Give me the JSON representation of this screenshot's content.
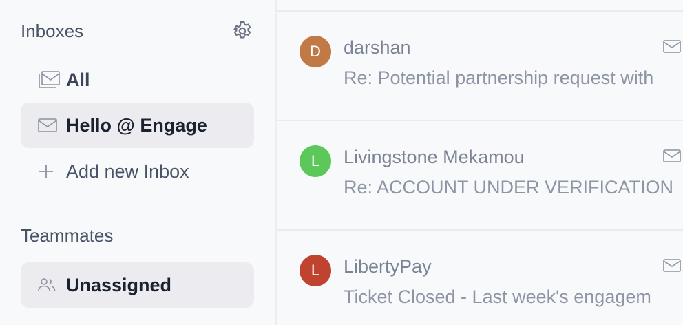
{
  "sidebar": {
    "inboxes_title": "Inboxes",
    "inbox_items": [
      {
        "label": "All",
        "icon": "inbox-stack-icon"
      },
      {
        "label": "Hello @ Engage",
        "icon": "mail-icon"
      },
      {
        "label": "Add new Inbox",
        "icon": "plus-icon"
      }
    ],
    "teammates_title": "Teammates",
    "teammate_items": [
      {
        "label": "Unassigned",
        "icon": "users-icon"
      }
    ]
  },
  "conversations": [
    {
      "initial": "D",
      "name": "darshan",
      "preview": "Re: Potential partnership request with",
      "avatar_color": "#c17a45"
    },
    {
      "initial": "L",
      "name": "Livingstone Mekamou",
      "preview": "Re: ACCOUNT UNDER VERIFICATION",
      "avatar_color": "#5cc85a"
    },
    {
      "initial": "L",
      "name": "LibertyPay",
      "preview": "Ticket Closed - Last week's engagem",
      "avatar_color": "#c0432f"
    }
  ]
}
